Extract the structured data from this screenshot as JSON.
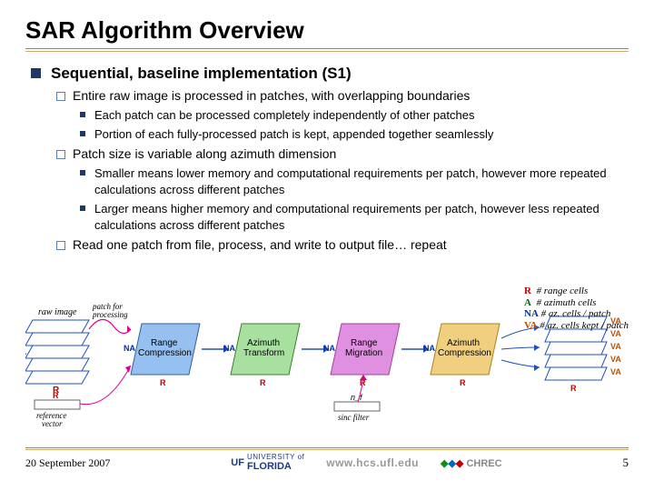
{
  "title": "SAR Algorithm Overview",
  "main_bullet": "Sequential, baseline implementation (S1)",
  "sub": [
    {
      "text": "Entire raw image is processed in patches, with overlapping boundaries",
      "children": [
        "Each patch can be processed completely independently of other patches",
        "Portion of each fully-processed patch is kept, appended together seamlessly"
      ]
    },
    {
      "text": "Patch size is variable along azimuth dimension",
      "children": [
        "Smaller means lower memory and computational requirements per patch, however more repeated calculations across different patches",
        "Larger means higher memory and computational requirements per patch, however less repeated calculations across different patches"
      ]
    },
    {
      "text": "Read one patch from file, process, and write to output file… repeat",
      "children": []
    }
  ],
  "diagram": {
    "raw_image_label": "raw image",
    "patch_for_processing_label": "patch for\nprocessing",
    "reference_vector_label": "reference\nvector",
    "sinc_filter_label": "sinc filter",
    "nf_label": "n_f",
    "dim_R": "R",
    "dim_A": "A",
    "dim_NA": "NA",
    "dim_VA": "VA",
    "stage1": "Range\nCompression",
    "stage2": "Azimuth\nTransform",
    "stage3": "Range\nMigration",
    "stage4": "Azimuth\nCompression"
  },
  "legend": {
    "R": "# range cells",
    "A": "# azimuth cells",
    "NA": "# az. cells / patch",
    "VA": "# az. cells kept / patch"
  },
  "footer": {
    "date": "20 September 2007",
    "uf_top": "UNIVERSITY of",
    "uf_bottom": "FLORIDA",
    "hcs": "www.hcs.ufl.edu",
    "chrec": "CHREC",
    "page": "5"
  }
}
